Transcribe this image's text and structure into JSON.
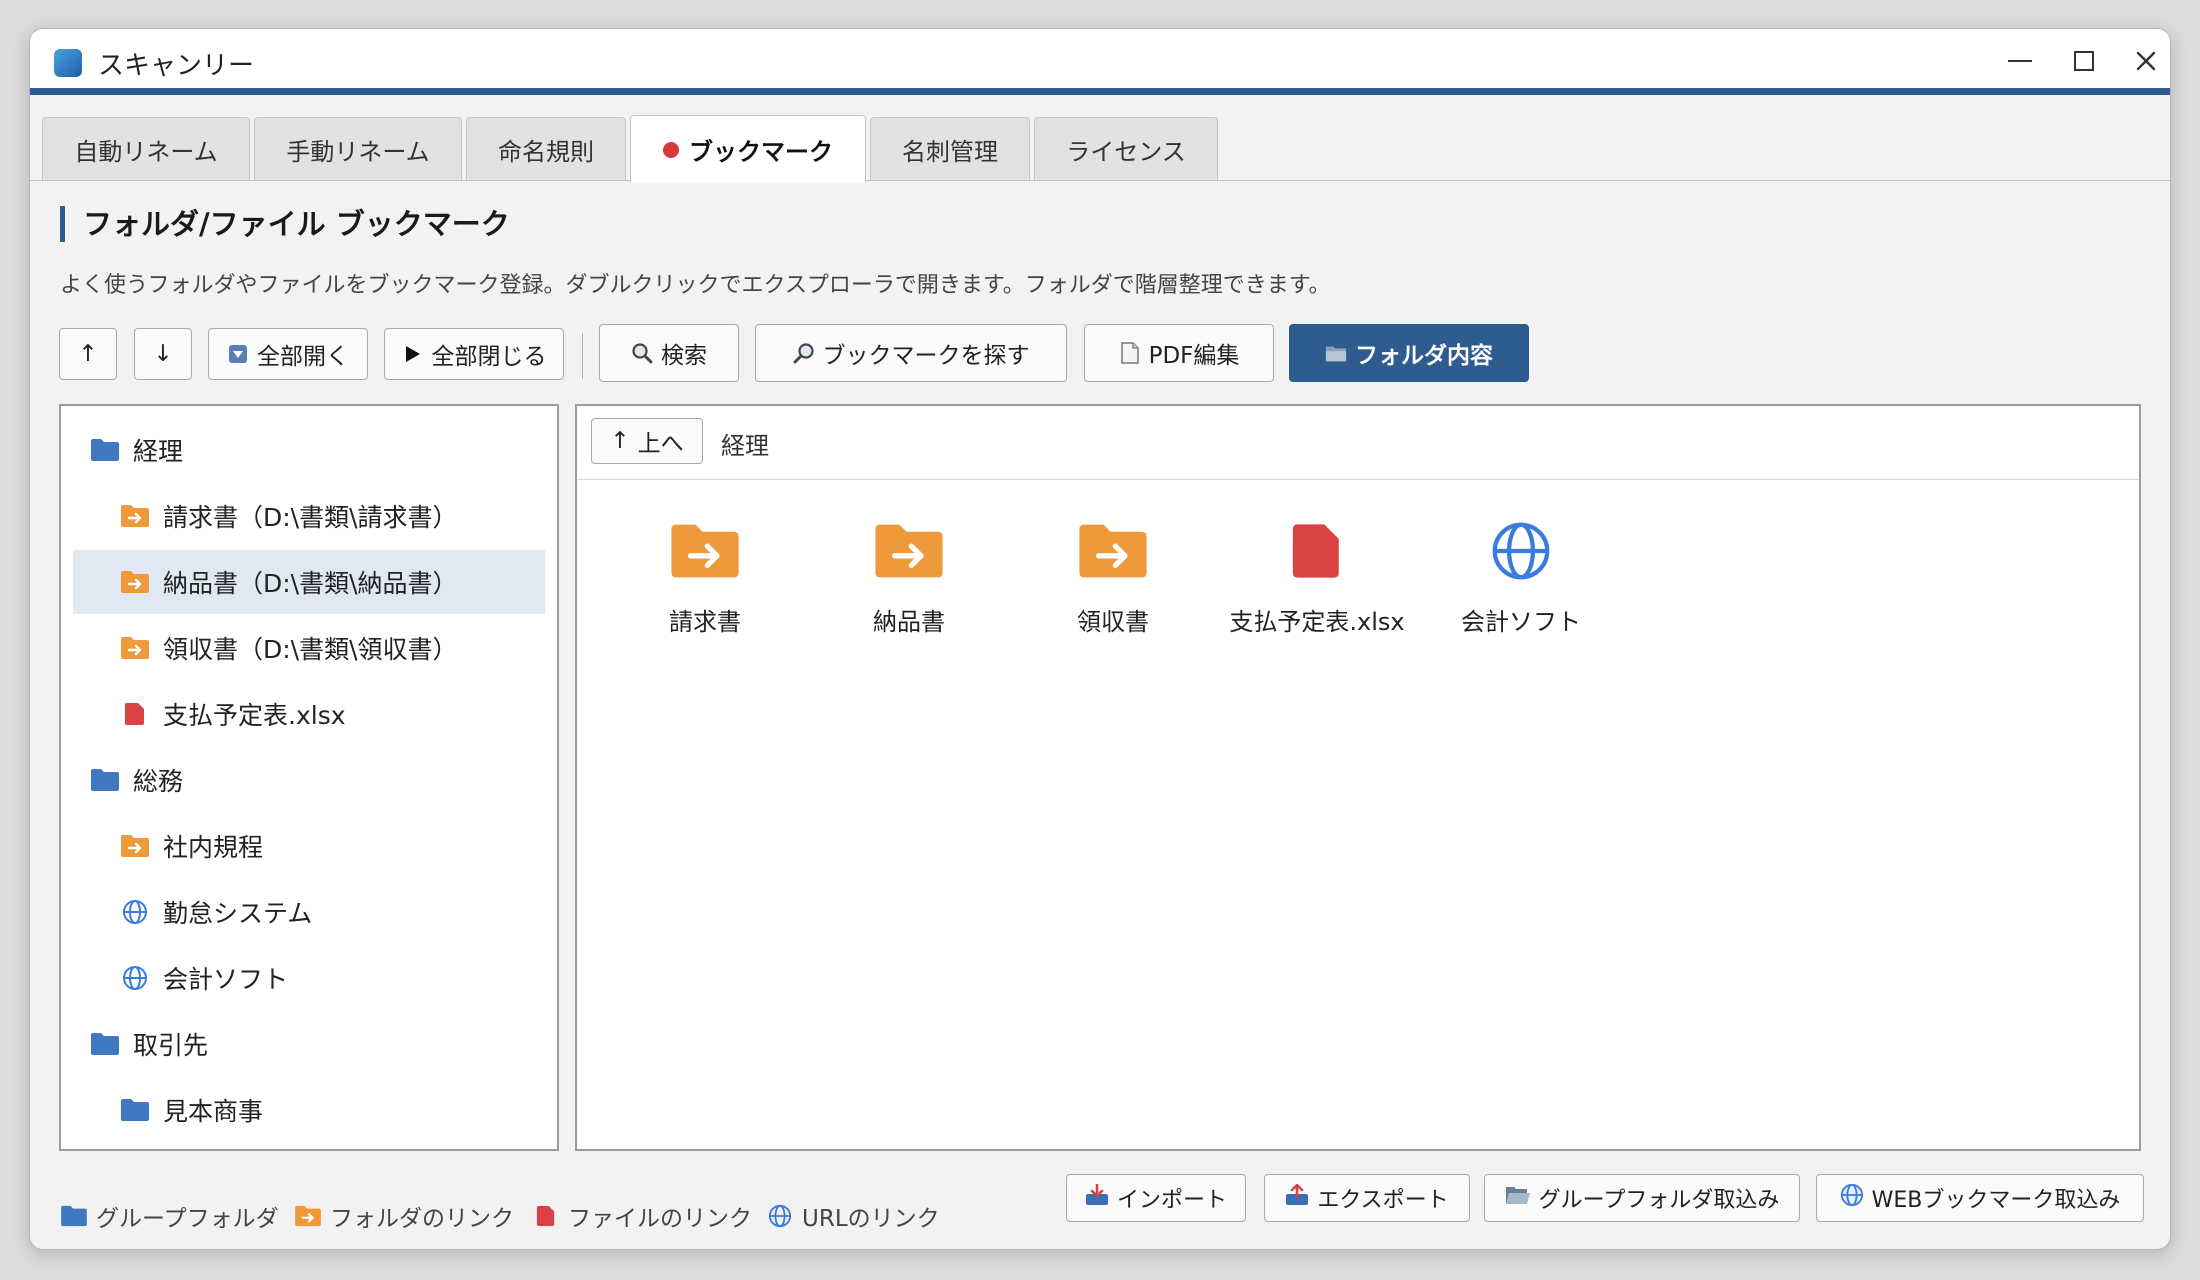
{
  "window": {
    "title": "スキャンリー"
  },
  "tabs": [
    {
      "label": "自動リネーム"
    },
    {
      "label": "手動リネーム"
    },
    {
      "label": "命名規則"
    },
    {
      "label": "ブックマーク",
      "active": true
    },
    {
      "label": "名刺管理"
    },
    {
      "label": "ライセンス"
    }
  ],
  "section": {
    "title": "フォルダ/ファイル ブックマーク",
    "description": "よく使うフォルダやファイルをブックマーク登録。ダブルクリックでエクスプローラで開きます。フォルダで階層整理できます。"
  },
  "toolbar": {
    "up": "↑",
    "down": "↓",
    "expand_all": "全部開く",
    "collapse_all": "全部閉じる",
    "search": "検索",
    "find_bookmark": "ブックマークを探す",
    "pdf_edit": "PDF編集",
    "folder_contents": "フォルダ内容"
  },
  "tree": [
    {
      "label": "経理",
      "type": "group",
      "level": 0
    },
    {
      "label": "請求書（D:\\書類\\請求書）",
      "type": "folder-link",
      "level": 1
    },
    {
      "label": "納品書（D:\\書類\\納品書）",
      "type": "folder-link",
      "level": 1,
      "selected": true
    },
    {
      "label": "領収書（D:\\書類\\領収書）",
      "type": "folder-link",
      "level": 1
    },
    {
      "label": "支払予定表.xlsx",
      "type": "file-link",
      "level": 1
    },
    {
      "label": "総務",
      "type": "group",
      "level": 0
    },
    {
      "label": "社内規程",
      "type": "folder-link",
      "level": 1
    },
    {
      "label": "勤怠システム",
      "type": "url-link",
      "level": 1
    },
    {
      "label": "会計ソフト",
      "type": "url-link",
      "level": 1
    },
    {
      "label": "取引先",
      "type": "group",
      "level": 0
    },
    {
      "label": "見本商事",
      "type": "group",
      "level": 1
    }
  ],
  "content": {
    "up_label": "上へ",
    "current_path": "経理",
    "items": [
      {
        "label": "請求書",
        "type": "folder-link"
      },
      {
        "label": "納品書",
        "type": "folder-link"
      },
      {
        "label": "領収書",
        "type": "folder-link"
      },
      {
        "label": "支払予定表.xlsx",
        "type": "file-link"
      },
      {
        "label": "会計ソフト",
        "type": "url-link"
      }
    ]
  },
  "legend": {
    "group_folder": "グループフォルダ",
    "folder_link": "フォルダのリンク",
    "file_link": "ファイルのリンク",
    "url_link": "URLのリンク"
  },
  "bottom_buttons": {
    "import": "インポート",
    "export": "エクスポート",
    "import_group_folder": "グループフォルダ取込み",
    "import_web_bookmarks": "WEBブックマーク取込み"
  },
  "colors": {
    "accent": "#2f5c8f",
    "folder_group": "#3f78c1",
    "folder_link": "#ee9a3a",
    "file_link": "#d94343",
    "url_link": "#3a7be0",
    "selected_row": "#dfe8f3"
  }
}
